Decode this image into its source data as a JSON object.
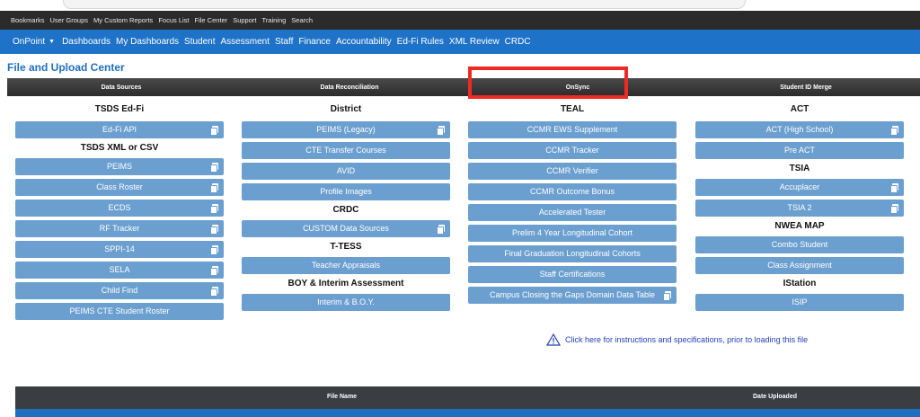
{
  "utility_bar": [
    "Bookmarks",
    "User Groups",
    "My Custom Reports",
    "Focus List",
    "File Center",
    "Support",
    "Training",
    "Search"
  ],
  "nav": {
    "brand": "OnPoint",
    "items": [
      "Dashboards",
      "My Dashboards",
      "Student",
      "Assessment",
      "Staff",
      "Finance",
      "Accountability",
      "Ed-Fi Rules",
      "XML Review",
      "CRDC"
    ]
  },
  "page_title": "File and Upload Center",
  "tabs": [
    "Data Sources",
    "Data Reconciliation",
    "OnSync",
    "Student ID Merge"
  ],
  "columns": [
    {
      "sections": [
        {
          "heading": "TSDS Ed-Fi",
          "buttons": [
            {
              "label": "Ed-Fi API",
              "copy": true
            }
          ]
        },
        {
          "heading": "TSDS XML or CSV",
          "buttons": [
            {
              "label": "PEIMS",
              "copy": true
            },
            {
              "label": "Class Roster",
              "copy": true
            },
            {
              "label": "ECDS",
              "copy": true
            },
            {
              "label": "RF Tracker",
              "copy": true
            },
            {
              "label": "SPPI-14",
              "copy": true
            },
            {
              "label": "SELA",
              "copy": true
            },
            {
              "label": "Child Find",
              "copy": true
            },
            {
              "label": "PEIMS CTE Student Roster",
              "copy": false
            }
          ]
        }
      ]
    },
    {
      "sections": [
        {
          "heading": "District",
          "buttons": [
            {
              "label": "PEIMS (Legacy)",
              "copy": true
            },
            {
              "label": "CTE Transfer Courses",
              "copy": false
            },
            {
              "label": "AVID",
              "copy": false
            },
            {
              "label": "Profile Images",
              "copy": false
            }
          ]
        },
        {
          "heading": "CRDC",
          "buttons": [
            {
              "label": "CUSTOM Data Sources",
              "copy": true
            }
          ]
        },
        {
          "heading": "T-TESS",
          "buttons": [
            {
              "label": "Teacher Appraisals",
              "copy": false
            }
          ]
        },
        {
          "heading": "BOY & Interim Assessment",
          "buttons": [
            {
              "label": "Interim & B.O.Y.",
              "copy": false
            }
          ]
        }
      ]
    },
    {
      "sections": [
        {
          "heading": "TEAL",
          "buttons": [
            {
              "label": "CCMR EWS Supplement",
              "copy": false
            },
            {
              "label": "CCMR Tracker",
              "copy": false
            },
            {
              "label": "CCMR Verifier",
              "copy": false
            },
            {
              "label": "CCMR Outcome Bonus",
              "copy": false
            },
            {
              "label": "Accelerated Tester",
              "copy": false
            },
            {
              "label": "Prelim 4 Year Longitudinal Cohort",
              "copy": false
            },
            {
              "label": "Final Graduation Longitudinal Cohorts",
              "copy": false
            },
            {
              "label": "Staff Certifications",
              "copy": false
            },
            {
              "label": "Campus Closing the Gaps Domain Data Table",
              "copy": true
            }
          ]
        }
      ]
    },
    {
      "sections": [
        {
          "heading": "ACT",
          "buttons": [
            {
              "label": "ACT (High School)",
              "copy": true
            },
            {
              "label": "Pre ACT",
              "copy": false
            }
          ]
        },
        {
          "heading": "TSIA",
          "buttons": [
            {
              "label": "Accuplacer",
              "copy": true
            },
            {
              "label": "TSIA 2",
              "copy": true
            }
          ]
        },
        {
          "heading": "NWEA MAP",
          "buttons": [
            {
              "label": "Combo Student",
              "copy": false
            },
            {
              "label": "Class Assignment",
              "copy": false
            }
          ]
        },
        {
          "heading": "IStation",
          "buttons": [
            {
              "label": "ISIP",
              "copy": false
            }
          ]
        }
      ]
    }
  ],
  "info_link": "Click here for instructions and specifications, prior to loading this file",
  "table": {
    "columns": [
      "File Name",
      "Date Uploaded"
    ]
  },
  "colors": {
    "nav": "#1e73c8",
    "button": "#6b9fd0",
    "highlight": "#ee2a24"
  }
}
